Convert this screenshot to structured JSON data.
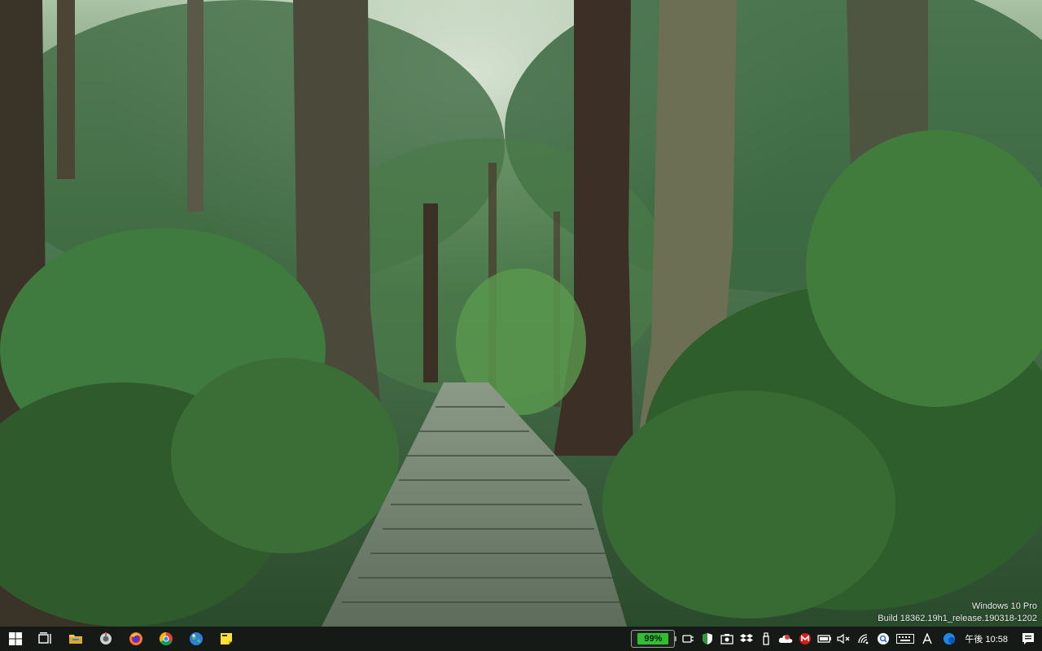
{
  "desktop": {
    "wallpaper": "forest-stone-steps",
    "watermark": {
      "edition": "Windows 10 Pro",
      "build": "Build 18362.19h1_release.190318-1202"
    }
  },
  "taskbar": {
    "pinned": [
      {
        "name": "start-button",
        "icon": "windows-logo-icon"
      },
      {
        "name": "task-view-button",
        "icon": "task-view-icon"
      },
      {
        "name": "file-explorer-button",
        "icon": "folder-icon"
      },
      {
        "name": "app-button-1",
        "icon": "tool-icon"
      },
      {
        "name": "firefox-button",
        "icon": "firefox-icon"
      },
      {
        "name": "chrome-button",
        "icon": "chrome-icon"
      },
      {
        "name": "globe-app-button",
        "icon": "globe-icon"
      },
      {
        "name": "sticky-notes-button",
        "icon": "sticky-note-icon"
      }
    ],
    "battery_percent": "99%",
    "clock": "午後 10:58",
    "colors": {
      "taskbar": "#161a16",
      "battery_fill": "#2fbf2f",
      "accent_blue": "#1e88e5"
    }
  }
}
